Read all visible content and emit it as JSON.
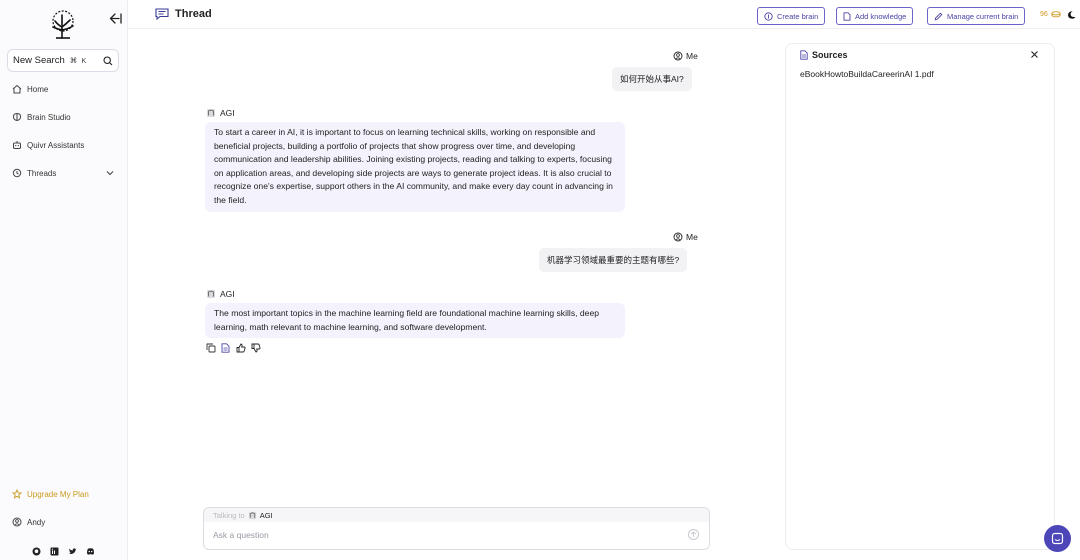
{
  "sidebar": {
    "search_label": "New Search",
    "search_shortcut": "⌘ K",
    "items": [
      {
        "label": "Home",
        "icon": "home-icon"
      },
      {
        "label": "Brain Studio",
        "icon": "brain-icon"
      },
      {
        "label": "Quivr Assistants",
        "icon": "assistant-icon"
      },
      {
        "label": "Threads",
        "icon": "history-icon"
      }
    ],
    "upgrade_label": "Upgrade My Plan",
    "user_name": "Andy"
  },
  "header": {
    "title": "Thread",
    "create_brain": "Create brain",
    "add_knowledge": "Add knowledge",
    "manage_brain": "Manage current brain",
    "credits": "96"
  },
  "messages": [
    {
      "role": "user",
      "name": "Me",
      "text": "如何开始从事AI?"
    },
    {
      "role": "assistant",
      "name": "AGI",
      "text": "To start a career in AI, it is important to focus on learning technical skills, working on responsible and beneficial projects, building a portfolio of projects that show progress over time, and developing communication and leadership abilities. Joining existing projects, reading and talking to experts, focusing on application areas, and developing side projects are ways to generate project ideas. It is also crucial to recognize one's expertise, support others in the AI community, and make every day count in advancing in the field."
    },
    {
      "role": "user",
      "name": "Me",
      "text": "机器学习领域最重要的主题有哪些?"
    },
    {
      "role": "assistant",
      "name": "AGI",
      "text": "The most important topics in the machine learning field are foundational machine learning skills, deep learning, math relevant to machine learning, and software development."
    }
  ],
  "sources": {
    "title": "Sources",
    "files": [
      "eBookHowtoBuildaCareerinAI 1.pdf"
    ]
  },
  "chat": {
    "talking_to": "Talking to",
    "brain": "AGI",
    "placeholder": "Ask a question"
  },
  "colors": {
    "accent": "#4c46b8",
    "bubble_assistant": "#f4f2fc",
    "bubble_user": "#f2f2f5",
    "upgrade": "#c99a1c"
  }
}
